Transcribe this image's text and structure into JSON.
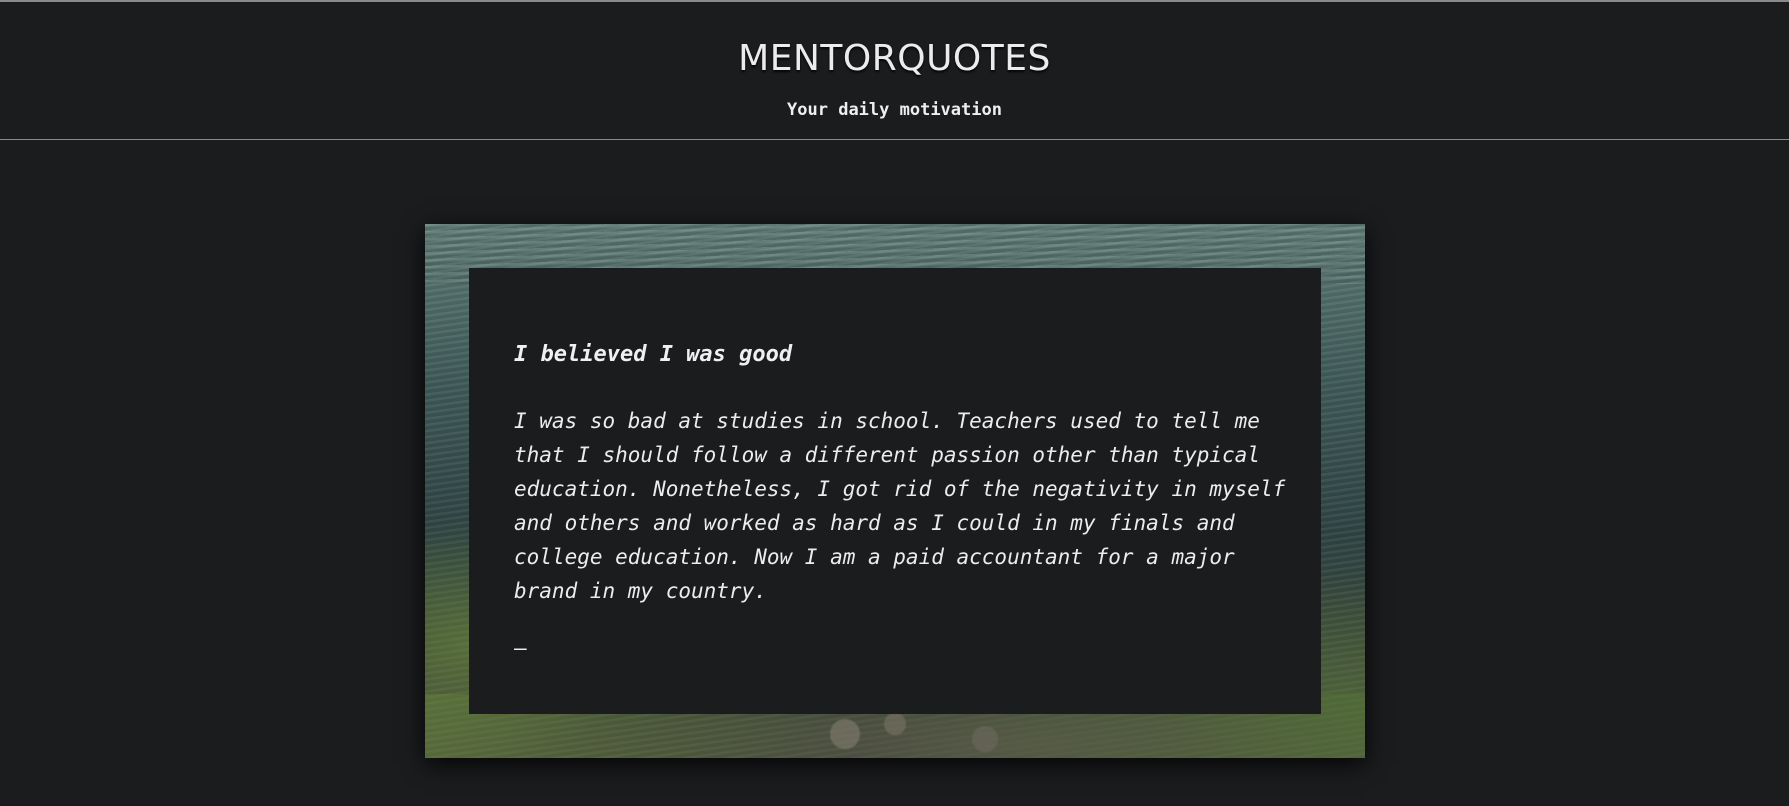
{
  "header": {
    "title": "MENTORQUOTES",
    "tagline": "Your daily motivation"
  },
  "quote": {
    "title": "I believed I was good",
    "body": "I was so bad at studies in school. Teachers used to tell me that I should follow a different passion other than typical education. Nonetheless, I got rid of the negativity in myself and others and worked as hard as I could in my finals and college education. Now I am a paid accountant for a major brand in my country.",
    "author": "–"
  },
  "colors": {
    "background": "#1b1c1e",
    "text": "#e8e8e8",
    "divider": "#8a8a8a"
  }
}
